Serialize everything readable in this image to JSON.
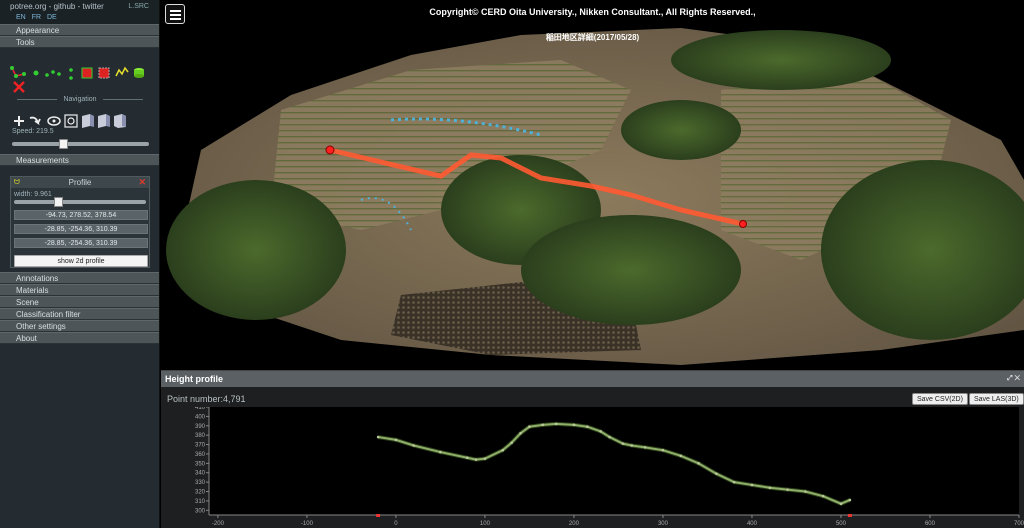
{
  "sidebar": {
    "brand": "potree.org - github - twitter",
    "lsrc": "L.SRC",
    "languages": [
      "EN",
      "FR",
      "DE"
    ],
    "sections": {
      "appearance": "Appearance",
      "tools": "Tools",
      "measurements": "Measurements",
      "annotations": "Annotations",
      "materials": "Materials",
      "scene": "Scene",
      "classification_filter": "Classification filter",
      "other_settings": "Other settings",
      "about": "About"
    },
    "navigation_title": "Navigation",
    "speed_label": "Speed: 219.5",
    "speed_level": 0.37,
    "profile": {
      "title": "Profile",
      "width_label": "width: 9.961",
      "width_level": 0.33,
      "coords": [
        "-94.73, 278.52, 378.54",
        "-28.85, -254.36, 310.39",
        "-28.85, -254.36, 310.39"
      ],
      "show_button": "show 2d profile"
    }
  },
  "viewport": {
    "copyright": "Copyright© CERD Oita University., Nikken Consultant., All Rights Reserved.,",
    "title": "稲田地区詳細(2017/05/28)"
  },
  "height_profile": {
    "title": "Height profile",
    "point_number": "Point number:4,791",
    "save_csv": "Save CSV(2D)",
    "save_las": "Save LAS(3D)",
    "window_controls": "⤢ ✕"
  },
  "chart_data": {
    "type": "line",
    "title": "",
    "xlabel": "",
    "ylabel": "",
    "xlim": [
      -210,
      700
    ],
    "ylim": [
      295,
      410
    ],
    "xticks": [
      -200,
      -100,
      0,
      100,
      200,
      300,
      400,
      500,
      600,
      700
    ],
    "yticks": [
      300,
      310,
      320,
      330,
      340,
      350,
      360,
      370,
      380,
      390,
      400,
      410
    ],
    "grid": false,
    "series": [
      {
        "color": "#8fae6a",
        "x": [
          -20,
          0,
          20,
          50,
          80,
          90,
          100,
          120,
          130,
          140,
          150,
          165,
          180,
          200,
          215,
          230,
          240,
          255,
          265,
          280,
          300,
          320,
          340,
          360,
          380,
          400,
          420,
          440,
          460,
          480,
          500,
          510
        ],
        "y": [
          378,
          375,
          369,
          362,
          356,
          354,
          355,
          364,
          372,
          382,
          389,
          391,
          392,
          391,
          389,
          384,
          378,
          371,
          369,
          367,
          364,
          358,
          350,
          339,
          330,
          327,
          324,
          322,
          320,
          315,
          307,
          311
        ]
      }
    ],
    "markers": {
      "color": "#e33",
      "x": [
        -20,
        510
      ]
    }
  },
  "colors": {
    "sidebar_bg": "#242c31",
    "section_bg": "#4d5559",
    "profile_line": "#ff5a32",
    "marker": "#ff2020"
  }
}
